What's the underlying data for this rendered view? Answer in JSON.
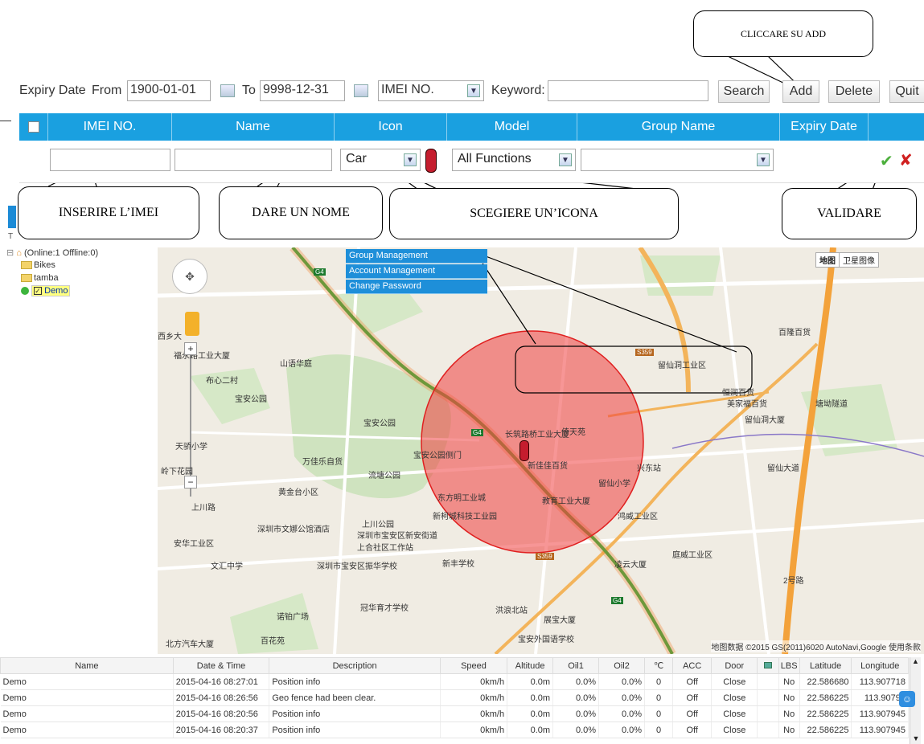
{
  "callouts": {
    "add": "CLICCARE SU ADD",
    "imei": "INSERIRE L’IMEI",
    "name": "DARE UN NOME",
    "icon": "SCEGIERE UN’ICONA",
    "validate": "VALIDARE"
  },
  "search": {
    "expiry_label": "Expiry Date",
    "from_label": "From",
    "from_value": "1900-01-01",
    "to_label": "To",
    "to_value": "9998-12-31",
    "field_select": "IMEI NO.",
    "keyword_label": "Keyword:",
    "keyword_value": "",
    "search_btn": "Search",
    "add_btn": "Add",
    "delete_btn": "Delete",
    "quit_btn": "Quit"
  },
  "grid": {
    "headers": [
      "IMEI NO.",
      "Name",
      "Icon",
      "Model",
      "Group Name",
      "Expiry Date"
    ],
    "new_row": {
      "imei": "",
      "name": "",
      "icon": "Car",
      "model": "All Functions",
      "group": ""
    }
  },
  "tree": {
    "root": "(Online:1  Offline:0)",
    "folders": [
      "Bikes",
      "tamba"
    ],
    "device": "Demo"
  },
  "menu": [
    "Group Management",
    "Account Management",
    "Change Password"
  ],
  "map": {
    "type_tabs": [
      "地图",
      "卫星图像"
    ],
    "roads": [
      "G4",
      "G4",
      "G4",
      "S359",
      "S359"
    ],
    "labels": [
      "西乡大",
      "福永路工业大厦",
      "山语华庭",
      "布心二村",
      "宝安公园",
      "宝安公园",
      "天骄小学",
      "宝安公园侧门",
      "万佳乐自货",
      "流塘公园",
      "岭下花园",
      "黄金台小区",
      "上川路",
      "长筑路桥工业大厦",
      "倚天苑",
      "留仙洞工业区",
      "恒润百货",
      "美家福百货",
      "留仙洞大厦",
      "塘坳隧道",
      "百隆百货",
      "新佳佳百货",
      "兴东站",
      "留仙小学",
      "留仙大道",
      "东方明工业城",
      "教育工业大厦",
      "新柯城科技工业园",
      "鸿威工业区",
      "深圳市文娜公馆酒店",
      "上川公园",
      "深圳市宝安区新安街道上合社区工作站",
      "安华工业区",
      "文汇中学",
      "深圳市宝安区振华学校",
      "新丰学校",
      "庭威工业区",
      "凌云大厦",
      "冠华育才学校",
      "洪浪北站",
      "展宝大厦",
      "诺铂广场",
      "宝安外国语学校",
      "北方汽车大厦",
      "百花苑",
      "2号路"
    ],
    "copyright": "地图数据 ©2015 GS(2011)6020 AutoNavi,Google   使用条款"
  },
  "table": {
    "headers": [
      "Name",
      "Date & Time",
      "Description",
      "Speed",
      "Altitude",
      "Oil1",
      "Oil2",
      "℃",
      "ACC",
      "Door",
      "",
      "LBS",
      "Latitude",
      "Longitude"
    ],
    "rows": [
      [
        "Demo",
        "2015-04-16 08:27:01",
        "Position info",
        "0km/h",
        "0.0m",
        "0.0%",
        "0.0%",
        "0",
        "Off",
        "Close",
        "",
        "No",
        "22.586680",
        "113.907718"
      ],
      [
        "Demo",
        "2015-04-16 08:26:56",
        "Geo fence had been clear.",
        "0km/h",
        "0.0m",
        "0.0%",
        "0.0%",
        "0",
        "Off",
        "Close",
        "",
        "No",
        "22.586225",
        "113.90794"
      ],
      [
        "Demo",
        "2015-04-16 08:20:56",
        "Position info",
        "0km/h",
        "0.0m",
        "0.0%",
        "0.0%",
        "0",
        "Off",
        "Close",
        "",
        "No",
        "22.586225",
        "113.907945"
      ],
      [
        "Demo",
        "2015-04-16 08:20:37",
        "Position info",
        "0km/h",
        "0.0m",
        "0.0%",
        "0.0%",
        "0",
        "Off",
        "Close",
        "",
        "No",
        "22.586225",
        "113.907945"
      ]
    ]
  }
}
